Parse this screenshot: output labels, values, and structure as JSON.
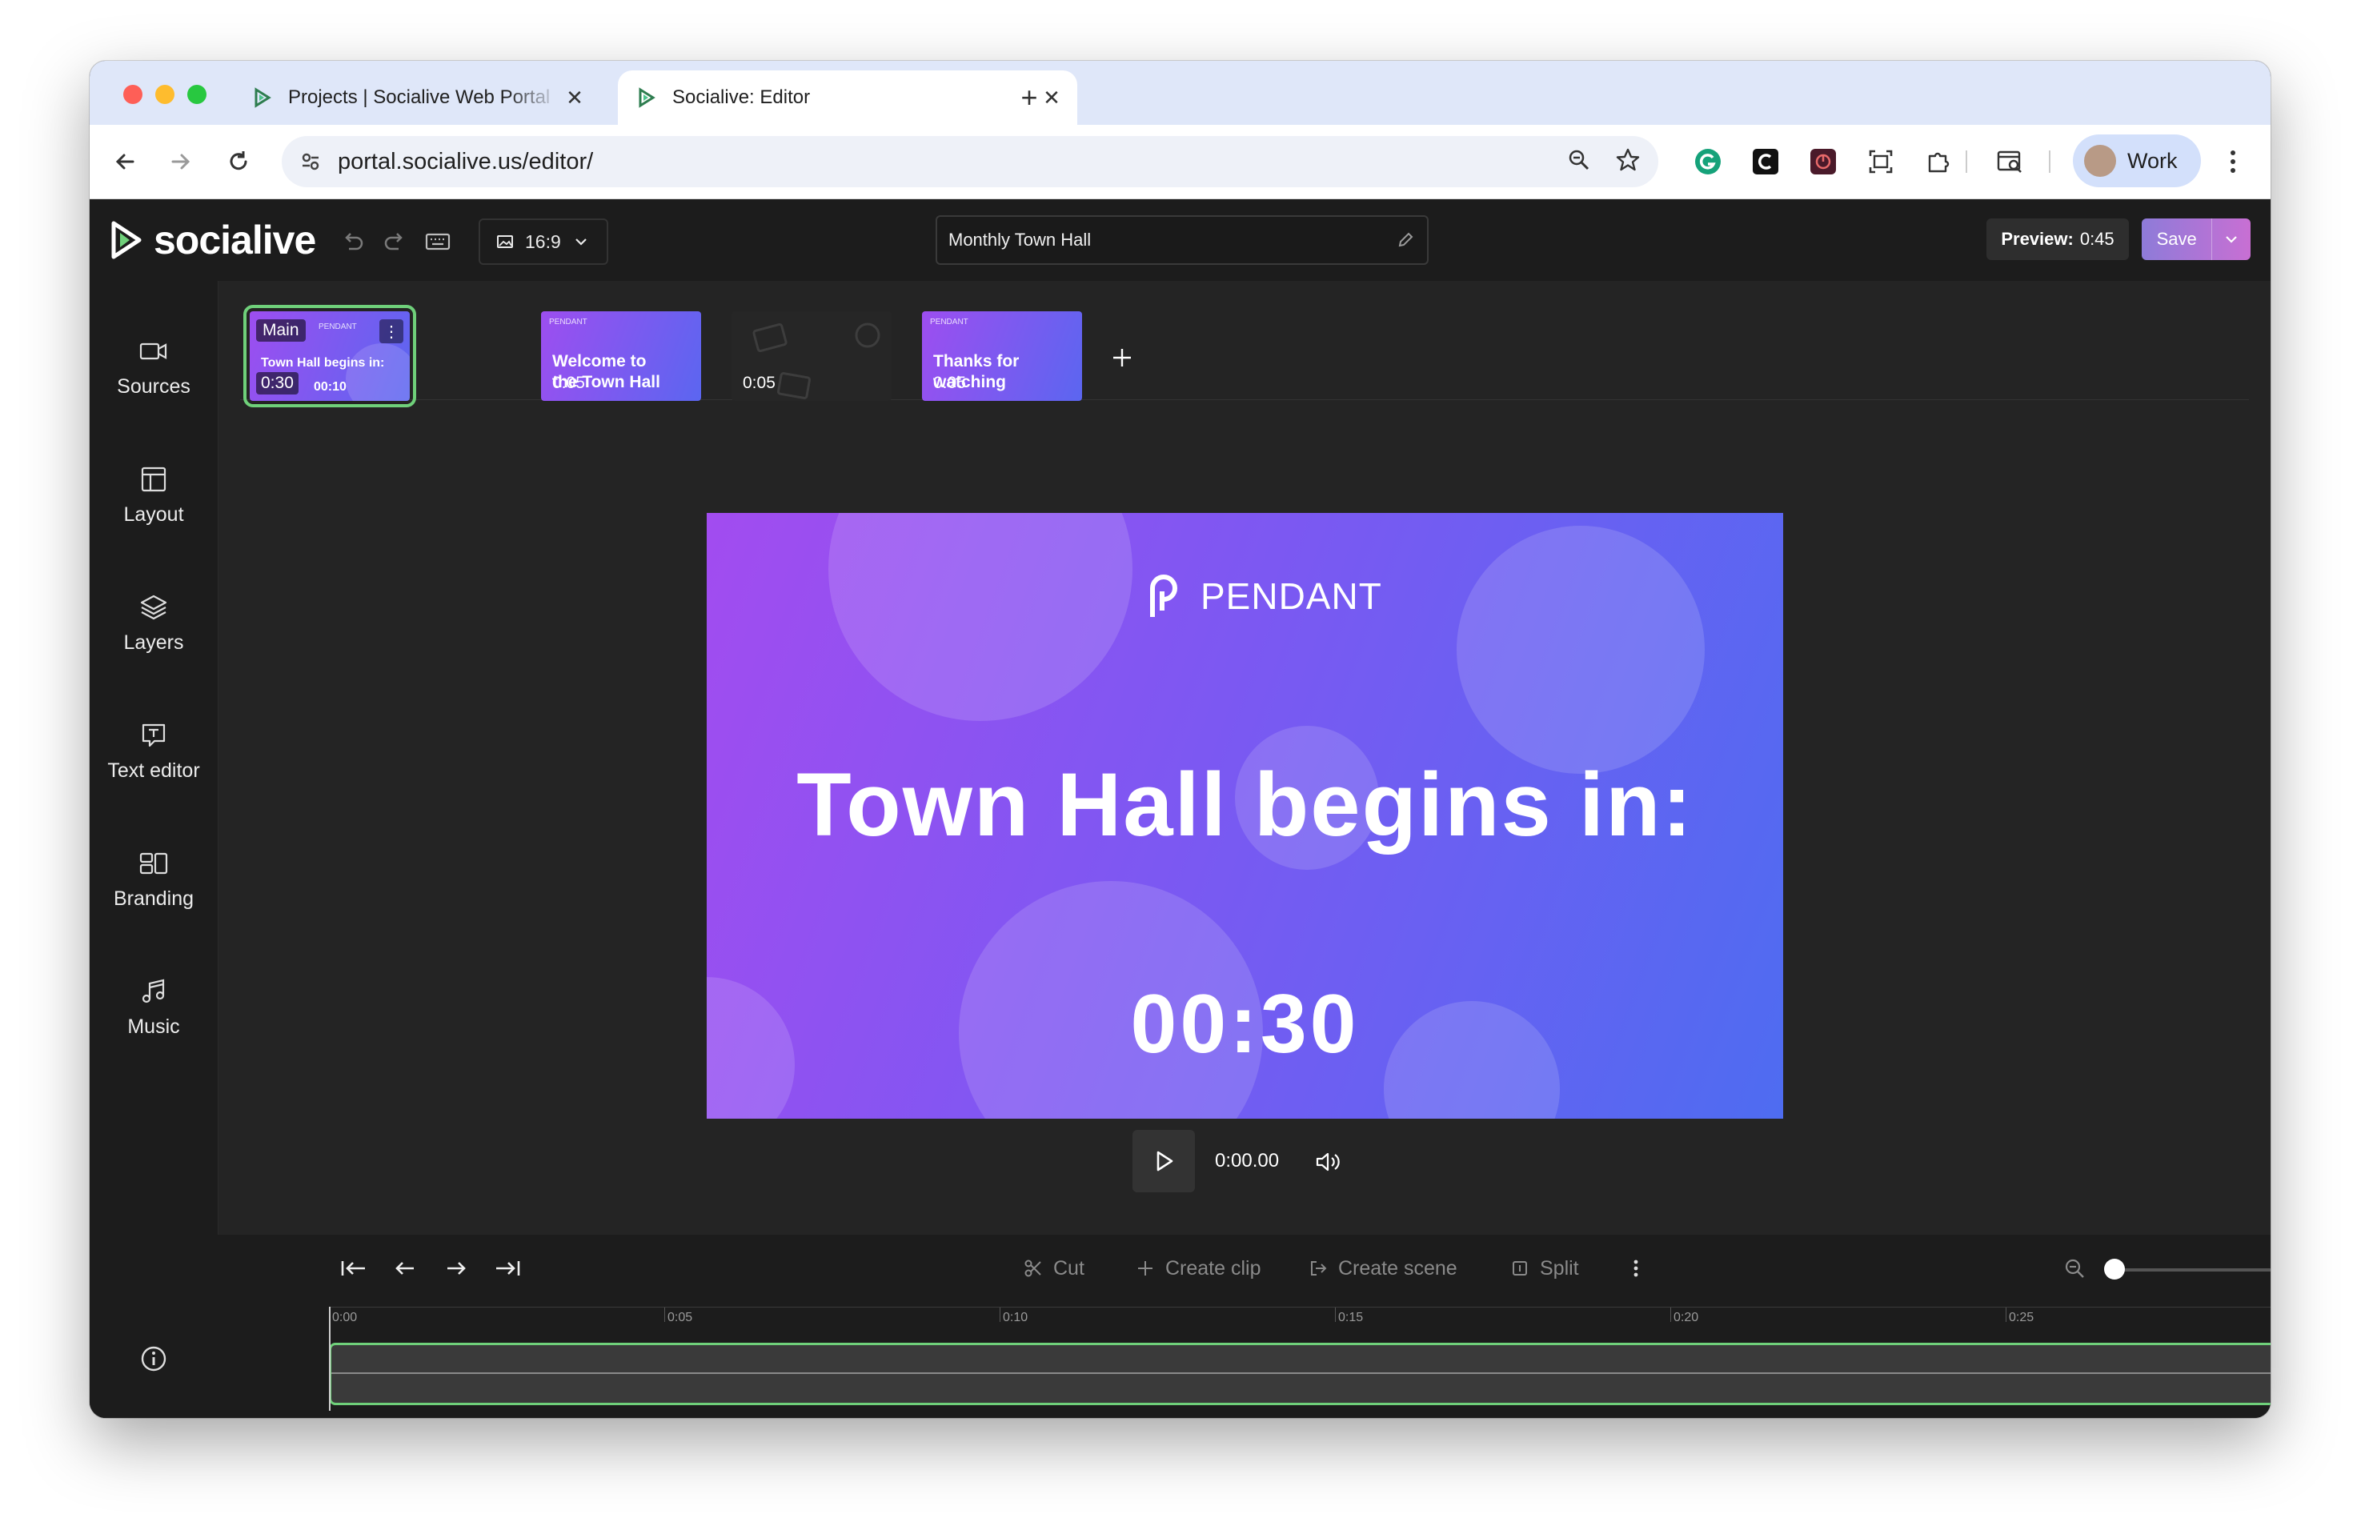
{
  "browser": {
    "tabs": [
      {
        "title": "Projects | Socialive Web Portal",
        "active": false
      },
      {
        "title": "Socialive: Editor",
        "active": true
      }
    ],
    "url": "portal.socialive.us/editor/",
    "profile": "Work",
    "new_tab_icon": "+",
    "close_icon": "✕"
  },
  "app": {
    "brand": "socialive",
    "aspect_ratio": "16:9",
    "project_name": "Monthly Town Hall",
    "preview_label": "Preview:",
    "preview_value": "0:45",
    "save_label": "Save",
    "accent_color": "#6fd07a"
  },
  "sidebar": {
    "items": [
      {
        "label": "Sources",
        "icon": "camera-icon"
      },
      {
        "label": "Layout",
        "icon": "layout-icon"
      },
      {
        "label": "Layers",
        "icon": "layers-icon"
      },
      {
        "label": "Text editor",
        "icon": "text-editor-icon"
      },
      {
        "label": "Branding",
        "icon": "branding-icon"
      },
      {
        "label": "Music",
        "icon": "music-icon"
      }
    ]
  },
  "scenes": [
    {
      "badge": "Main",
      "text": "Town Hall begins in:",
      "sub": "00:10",
      "duration": "0:30",
      "selected": true
    },
    {
      "text_line1": "Welcome to",
      "text_line2": "the Town Hall",
      "duration": "0:05"
    },
    {
      "duration": "0:05"
    },
    {
      "text_line1": "Thanks for",
      "text_line2": "watching",
      "duration": "0:05"
    }
  ],
  "canvas": {
    "logo_text": "PENDANT",
    "headline": "Town Hall begins in:",
    "countdown": "00:30"
  },
  "player": {
    "time": "0:00.00"
  },
  "timeline": {
    "actions": [
      "Cut",
      "Create clip",
      "Create scene",
      "Split"
    ],
    "ruler": [
      "0:00",
      "0:05",
      "0:10",
      "0:15",
      "0:20",
      "0:25"
    ],
    "zoom_level": 0.0
  }
}
